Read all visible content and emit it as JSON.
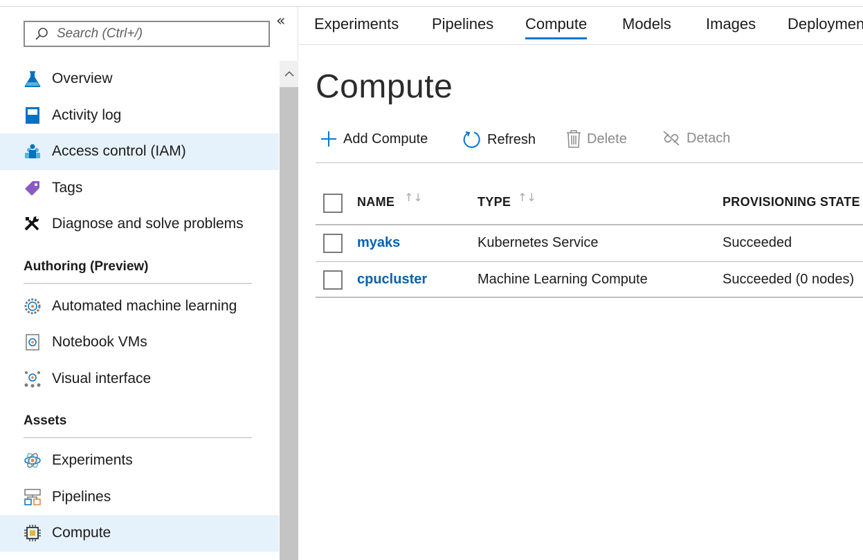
{
  "sidebar": {
    "search_placeholder": "Search (Ctrl+/)",
    "collapse_glyph": "«",
    "items": [
      {
        "label": "Overview",
        "icon": "flask-icon"
      },
      {
        "label": "Activity log",
        "icon": "log-book-icon"
      },
      {
        "label": "Access control (IAM)",
        "icon": "people-icon",
        "active": true
      },
      {
        "label": "Tags",
        "icon": "tag-icon"
      },
      {
        "label": "Diagnose and solve problems",
        "icon": "wrench-icon"
      }
    ],
    "authoring": {
      "title": "Authoring (Preview)",
      "items": [
        {
          "label": "Automated machine learning",
          "icon": "gear-icon"
        },
        {
          "label": "Notebook VMs",
          "icon": "notebook-icon"
        },
        {
          "label": "Visual interface",
          "icon": "network-icon"
        }
      ]
    },
    "assets": {
      "title": "Assets",
      "items": [
        {
          "label": "Experiments",
          "icon": "atom-icon"
        },
        {
          "label": "Pipelines",
          "icon": "pipeline-icon"
        },
        {
          "label": "Compute",
          "icon": "chip-icon",
          "active": true
        }
      ]
    }
  },
  "tabs": [
    "Experiments",
    "Pipelines",
    "Compute",
    "Models",
    "Images",
    "Deployments"
  ],
  "active_tab": "Compute",
  "page_title": "Compute",
  "toolbar": {
    "add": "Add Compute",
    "refresh": "Refresh",
    "delete": "Delete",
    "detach": "Detach"
  },
  "table": {
    "columns": [
      "NAME",
      "TYPE",
      "PROVISIONING STATE"
    ],
    "rows": [
      {
        "name": "myaks",
        "type": "Kubernetes Service",
        "state": "Succeeded"
      },
      {
        "name": "cpucluster",
        "type": "Machine Learning Compute",
        "state": "Succeeded (0 nodes)"
      }
    ]
  },
  "colors": {
    "accent": "#0078d4",
    "link": "#0063b1",
    "active_bg": "#e6f2fb"
  }
}
